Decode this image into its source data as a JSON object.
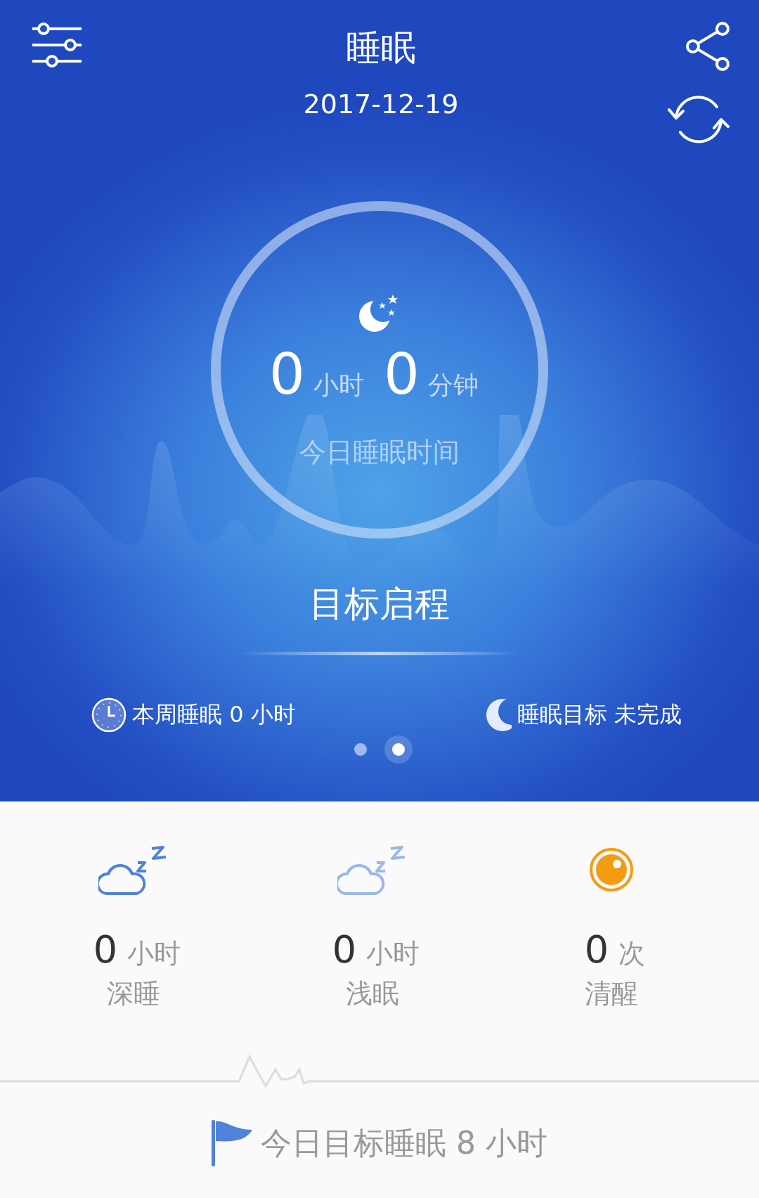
{
  "header": {
    "title": "睡眠",
    "date": "2017-12-19"
  },
  "summary": {
    "hours": "0",
    "hours_unit": "小时",
    "minutes": "0",
    "minutes_unit": "分钟",
    "caption": "今日睡眠时间"
  },
  "goal_heading": "目标启程",
  "info": [
    {
      "kind": "week",
      "text": "本周睡眠 0 小时"
    },
    {
      "kind": "goal",
      "text": "睡眠目标 未完成"
    }
  ],
  "pager": [
    {
      "selected": false
    },
    {
      "selected": true
    }
  ],
  "stats": [
    {
      "kind": "deep",
      "value": "0",
      "unit": "小时",
      "label": "深睡"
    },
    {
      "kind": "light",
      "value": "0",
      "unit": "小时",
      "label": "浅眠"
    },
    {
      "kind": "awake",
      "value": "0",
      "unit": "次",
      "label": "清醒"
    }
  ],
  "target": "今日目标睡眠 8 小时"
}
